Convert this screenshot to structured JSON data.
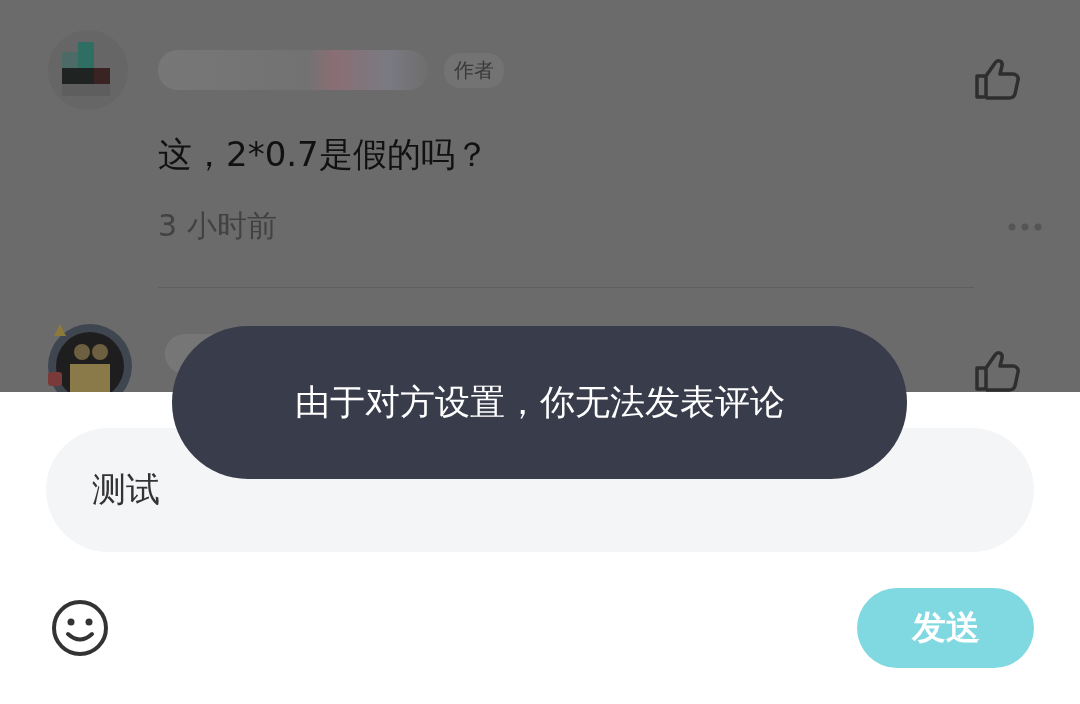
{
  "comments": [
    {
      "avatar": {
        "kind": "picture"
      },
      "author_badge": "作者",
      "text": "这，2*0.7是假的吗？",
      "time": "3 小时前"
    },
    {
      "avatar": {
        "kind": "picture"
      }
    }
  ],
  "toast": {
    "text": "由于对方设置，你无法发表评论"
  },
  "composer": {
    "input": {
      "value": "测试"
    },
    "send_button": {
      "label": "发送",
      "disabled": true
    }
  }
}
